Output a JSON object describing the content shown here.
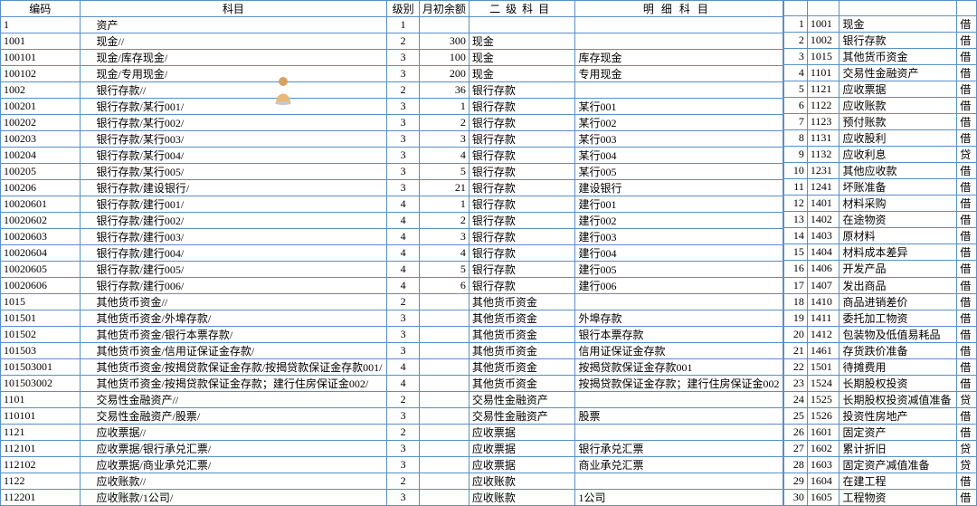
{
  "left": {
    "headers": [
      "编码",
      "科目",
      "级别",
      "月初余额",
      "二级科目",
      "明细科目"
    ],
    "rows": [
      {
        "c": "1",
        "s": "资产",
        "l": "1",
        "b": "",
        "s2": "",
        "d": ""
      },
      {
        "c": "1001",
        "s": "现金//",
        "l": "2",
        "b": "300",
        "s2": "现金",
        "d": ""
      },
      {
        "c": "100101",
        "s": "现金/库存现金/",
        "l": "3",
        "b": "100",
        "s2": "现金",
        "d": "库存现金"
      },
      {
        "c": "100102",
        "s": "现金/专用现金/",
        "l": "3",
        "b": "200",
        "s2": "现金",
        "d": "专用现金"
      },
      {
        "c": "1002",
        "s": "银行存款//",
        "l": "2",
        "b": "36",
        "s2": "银行存款",
        "d": ""
      },
      {
        "c": "100201",
        "s": "银行存款/某行001/",
        "l": "3",
        "b": "1",
        "s2": "银行存款",
        "d": "某行001"
      },
      {
        "c": "100202",
        "s": "银行存款/某行002/",
        "l": "3",
        "b": "2",
        "s2": "银行存款",
        "d": "某行002"
      },
      {
        "c": "100203",
        "s": "银行存款/某行003/",
        "l": "3",
        "b": "3",
        "s2": "银行存款",
        "d": "某行003"
      },
      {
        "c": "100204",
        "s": "银行存款/某行004/",
        "l": "3",
        "b": "4",
        "s2": "银行存款",
        "d": "某行004"
      },
      {
        "c": "100205",
        "s": "银行存款/某行005/",
        "l": "3",
        "b": "5",
        "s2": "银行存款",
        "d": "某行005"
      },
      {
        "c": "100206",
        "s": "银行存款/建设银行/",
        "l": "3",
        "b": "21",
        "s2": "银行存款",
        "d": "建设银行"
      },
      {
        "c": "10020601",
        "s": "银行存款/建行001/",
        "l": "4",
        "b": "1",
        "s2": "银行存款",
        "d": "建行001"
      },
      {
        "c": "10020602",
        "s": "银行存款/建行002/",
        "l": "4",
        "b": "2",
        "s2": "银行存款",
        "d": "建行002"
      },
      {
        "c": "10020603",
        "s": "银行存款/建行003/",
        "l": "4",
        "b": "3",
        "s2": "银行存款",
        "d": "建行003"
      },
      {
        "c": "10020604",
        "s": "银行存款/建行004/",
        "l": "4",
        "b": "4",
        "s2": "银行存款",
        "d": "建行004"
      },
      {
        "c": "10020605",
        "s": "银行存款/建行005/",
        "l": "4",
        "b": "5",
        "s2": "银行存款",
        "d": "建行005"
      },
      {
        "c": "10020606",
        "s": "银行存款/建行006/",
        "l": "4",
        "b": "6",
        "s2": "银行存款",
        "d": "建行006"
      },
      {
        "c": "1015",
        "s": "其他货币资金//",
        "l": "2",
        "b": "",
        "s2": "其他货币资金",
        "d": ""
      },
      {
        "c": "101501",
        "s": "其他货币资金/外埠存款/",
        "l": "3",
        "b": "",
        "s2": "其他货币资金",
        "d": "外埠存款"
      },
      {
        "c": "101502",
        "s": "其他货币资金/银行本票存款/",
        "l": "3",
        "b": "",
        "s2": "其他货币资金",
        "d": "银行本票存款"
      },
      {
        "c": "101503",
        "s": "其他货币资金/信用证保证金存款/",
        "l": "3",
        "b": "",
        "s2": "其他货币资金",
        "d": "信用证保证金存款"
      },
      {
        "c": "101503001",
        "s": "其他货币资金/按揭贷款保证金存款/按揭贷款保证金存款001/",
        "l": "4",
        "b": "",
        "s2": "其他货币资金",
        "d": "按揭贷款保证金存款001"
      },
      {
        "c": "101503002",
        "s": "其他货币资金/按揭贷款保证金存款；建行住房保证金002/",
        "l": "4",
        "b": "",
        "s2": "其他货币资金",
        "d": "按揭贷款保证金存款；建行住房保证金002"
      },
      {
        "c": "1101",
        "s": "交易性金融资产//",
        "l": "2",
        "b": "",
        "s2": "交易性金融资产",
        "d": ""
      },
      {
        "c": "110101",
        "s": "交易性金融资产/股票/",
        "l": "3",
        "b": "",
        "s2": "交易性金融资产",
        "d": "股票"
      },
      {
        "c": "1121",
        "s": "应收票据//",
        "l": "2",
        "b": "",
        "s2": "应收票据",
        "d": ""
      },
      {
        "c": "112101",
        "s": "应收票据/银行承兑汇票/",
        "l": "3",
        "b": "",
        "s2": "应收票据",
        "d": "银行承兑汇票"
      },
      {
        "c": "112102",
        "s": "应收票据/商业承兑汇票/",
        "l": "3",
        "b": "",
        "s2": "应收票据",
        "d": "商业承兑汇票"
      },
      {
        "c": "1122",
        "s": "应收账款//",
        "l": "2",
        "b": "",
        "s2": "应收账款",
        "d": ""
      },
      {
        "c": "112201",
        "s": "应收账款/1公司/",
        "l": "3",
        "b": "",
        "s2": "应收账款",
        "d": "1公司"
      }
    ]
  },
  "right": {
    "rows": [
      {
        "n": "1",
        "c": "1001",
        "name": "现金",
        "dc": "借"
      },
      {
        "n": "2",
        "c": "1002",
        "name": "银行存款",
        "dc": "借"
      },
      {
        "n": "3",
        "c": "1015",
        "name": "其他货币资金",
        "dc": "借"
      },
      {
        "n": "4",
        "c": "1101",
        "name": "交易性金融资产",
        "dc": "借"
      },
      {
        "n": "5",
        "c": "1121",
        "name": "应收票据",
        "dc": "借"
      },
      {
        "n": "6",
        "c": "1122",
        "name": "应收账款",
        "dc": "借"
      },
      {
        "n": "7",
        "c": "1123",
        "name": "预付账款",
        "dc": "借"
      },
      {
        "n": "8",
        "c": "1131",
        "name": "应收股利",
        "dc": "借"
      },
      {
        "n": "9",
        "c": "1132",
        "name": "应收利息",
        "dc": "贷"
      },
      {
        "n": "10",
        "c": "1231",
        "name": "其他应收款",
        "dc": "借"
      },
      {
        "n": "11",
        "c": "1241",
        "name": "坏账准备",
        "dc": "借"
      },
      {
        "n": "12",
        "c": "1401",
        "name": "材料采购",
        "dc": "借"
      },
      {
        "n": "13",
        "c": "1402",
        "name": "在途物资",
        "dc": "借"
      },
      {
        "n": "14",
        "c": "1403",
        "name": "原材料",
        "dc": "借"
      },
      {
        "n": "15",
        "c": "1404",
        "name": "材料成本差异",
        "dc": "借"
      },
      {
        "n": "16",
        "c": "1406",
        "name": "开发产品",
        "dc": "借"
      },
      {
        "n": "17",
        "c": "1407",
        "name": "发出商品",
        "dc": "借"
      },
      {
        "n": "18",
        "c": "1410",
        "name": "商品进销差价",
        "dc": "借"
      },
      {
        "n": "19",
        "c": "1411",
        "name": "委托加工物资",
        "dc": "借"
      },
      {
        "n": "20",
        "c": "1412",
        "name": "包装物及低值易耗品",
        "dc": "借"
      },
      {
        "n": "21",
        "c": "1461",
        "name": "存货跌价准备",
        "dc": "借"
      },
      {
        "n": "22",
        "c": "1501",
        "name": "待摊费用",
        "dc": "借"
      },
      {
        "n": "23",
        "c": "1524",
        "name": "长期股权投资",
        "dc": "借"
      },
      {
        "n": "24",
        "c": "1525",
        "name": "长期股权投资减值准备",
        "dc": "贷"
      },
      {
        "n": "25",
        "c": "1526",
        "name": "投资性房地产",
        "dc": "借"
      },
      {
        "n": "26",
        "c": "1601",
        "name": "固定资产",
        "dc": "借"
      },
      {
        "n": "27",
        "c": "1602",
        "name": "累计折旧",
        "dc": "贷"
      },
      {
        "n": "28",
        "c": "1603",
        "name": "固定资产减值准备",
        "dc": "贷"
      },
      {
        "n": "29",
        "c": "1604",
        "name": "在建工程",
        "dc": "借"
      },
      {
        "n": "30",
        "c": "1605",
        "name": "工程物资",
        "dc": "借"
      }
    ]
  }
}
